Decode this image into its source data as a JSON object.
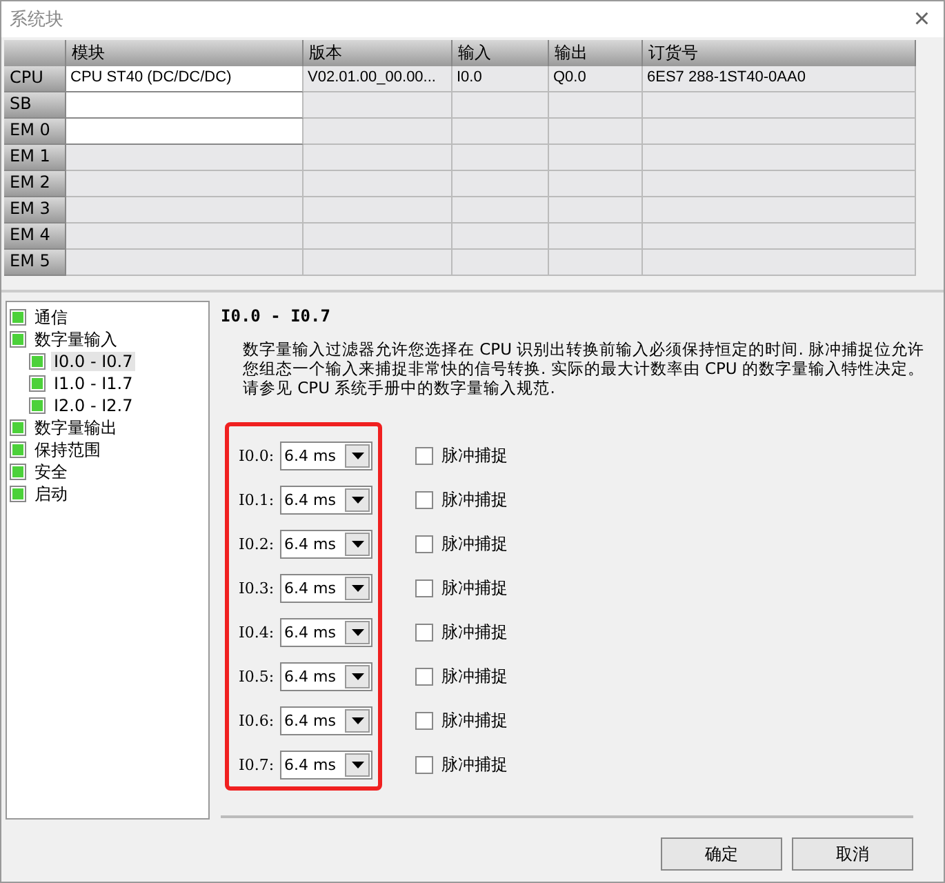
{
  "window": {
    "title": "系统块",
    "close": "×"
  },
  "table": {
    "columns": [
      "模块",
      "版本",
      "输入",
      "输出",
      "订货号"
    ],
    "rows": [
      {
        "header": "CPU",
        "cells": [
          "CPU ST40 (DC/DC/DC)",
          "V02.01.00_00.00...",
          "I0.0",
          "Q0.0",
          "6ES7 288-1ST40-0AA0"
        ],
        "editable": true
      },
      {
        "header": "SB",
        "cells": [],
        "editable": true
      },
      {
        "header": "EM 0",
        "cells": [],
        "editable": true
      },
      {
        "header": "EM 1",
        "cells": [],
        "editable": false
      },
      {
        "header": "EM 2",
        "cells": [],
        "editable": false
      },
      {
        "header": "EM 3",
        "cells": [],
        "editable": false
      },
      {
        "header": "EM 4",
        "cells": [],
        "editable": false
      },
      {
        "header": "EM 5",
        "cells": [],
        "editable": false
      }
    ]
  },
  "tree": [
    {
      "label": "通信",
      "selected": false
    },
    {
      "label": "数字量输入",
      "selected": false,
      "children": [
        {
          "label": "I0.0 - I0.7",
          "selected": true
        },
        {
          "label": "I1.0 - I1.7",
          "selected": false
        },
        {
          "label": "I2.0 - I2.7",
          "selected": false
        }
      ]
    },
    {
      "label": "数字量输出",
      "selected": false
    },
    {
      "label": "保持范围",
      "selected": false
    },
    {
      "label": "安全",
      "selected": false
    },
    {
      "label": "启动",
      "selected": false
    }
  ],
  "panel": {
    "heading": "I0.0 - I0.7",
    "description": "数字量输入过滤器允许您选择在 CPU 识别出转换前输入必须保持恒定的时间. 脉冲捕捉位允许您组态一个输入来捕捉非常快的信号转换. 实际的最大计数率由 CPU 的数字量输入特性决定。请参见 CPU 系统手册中的数字量输入规范.",
    "highlighted": true,
    "inputs": [
      {
        "label": "I0.0:",
        "value": "6.4 ms",
        "pulse_label": "脉冲捕捉",
        "checked": false
      },
      {
        "label": "I0.1:",
        "value": "6.4 ms",
        "pulse_label": "脉冲捕捉",
        "checked": false
      },
      {
        "label": "I0.2:",
        "value": "6.4 ms",
        "pulse_label": "脉冲捕捉",
        "checked": false
      },
      {
        "label": "I0.3:",
        "value": "6.4 ms",
        "pulse_label": "脉冲捕捉",
        "checked": false
      },
      {
        "label": "I0.4:",
        "value": "6.4 ms",
        "pulse_label": "脉冲捕捉",
        "checked": false
      },
      {
        "label": "I0.5:",
        "value": "6.4 ms",
        "pulse_label": "脉冲捕捉",
        "checked": false
      },
      {
        "label": "I0.6:",
        "value": "6.4 ms",
        "pulse_label": "脉冲捕捉",
        "checked": false
      },
      {
        "label": "I0.7:",
        "value": "6.4 ms",
        "pulse_label": "脉冲捕捉",
        "checked": false
      }
    ]
  },
  "buttons": [
    "确定",
    "取消"
  ]
}
